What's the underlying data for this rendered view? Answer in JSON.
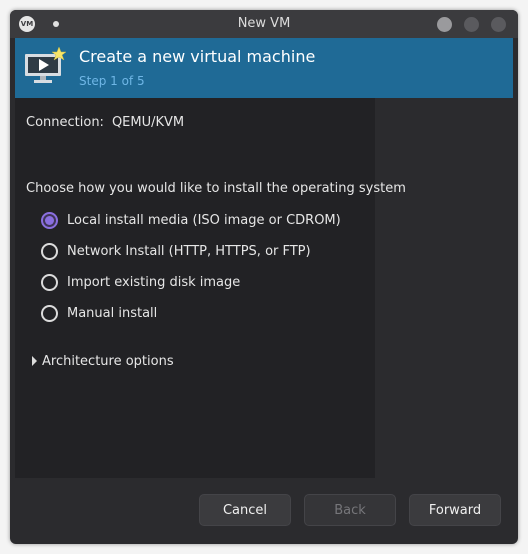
{
  "window": {
    "title": "New VM",
    "app_icon_text": "VM"
  },
  "header": {
    "title": "Create a new virtual machine",
    "step": "Step 1 of 5",
    "icon": "monitor-play-icon"
  },
  "connection": {
    "label": "Connection:",
    "value": "QEMU/KVM"
  },
  "install": {
    "prompt": "Choose how you would like to install the operating system",
    "options": [
      {
        "label": "Local install media (ISO image or CDROM)",
        "selected": true
      },
      {
        "label": "Network Install (HTTP, HTTPS, or FTP)",
        "selected": false
      },
      {
        "label": "Import existing disk image",
        "selected": false
      },
      {
        "label": "Manual install",
        "selected": false
      }
    ]
  },
  "architecture": {
    "label": "Architecture options",
    "expanded": false
  },
  "buttons": {
    "cancel": "Cancel",
    "back": "Back",
    "forward": "Forward",
    "back_enabled": false
  },
  "colors": {
    "header_bg": "#1f6a96",
    "step_text": "#6fb6e6",
    "radio_accent": "#8a6fe0"
  }
}
